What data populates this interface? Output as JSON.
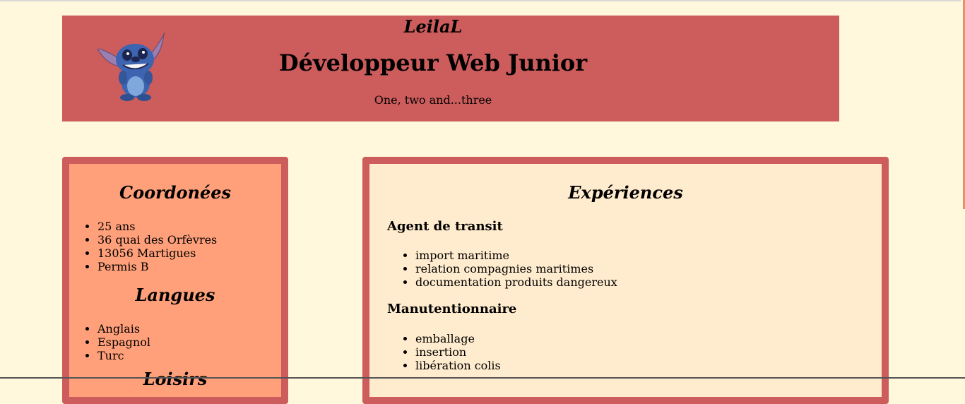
{
  "header": {
    "author": "LeilaL",
    "title": "Développeur Web Junior",
    "tagline": "One, two and...three",
    "logo_icon": "stitch-character-icon"
  },
  "contact": {
    "title": "Coordonées",
    "items": [
      "25 ans",
      "36 quai des Orfèvres",
      "13056 Martigues",
      "Permis B"
    ]
  },
  "languages": {
    "title": "Langues",
    "items": [
      "Anglais",
      "Espagnol",
      "Turc"
    ]
  },
  "hobbies": {
    "title": "Loisirs"
  },
  "experiences": {
    "title": "Expériences",
    "jobs": [
      {
        "title": "Agent de transit",
        "tasks": [
          "import maritime",
          "relation compagnies maritimes",
          "documentation produits dangereux"
        ]
      },
      {
        "title": "Manutentionnaire",
        "tasks": [
          "emballage",
          "insertion",
          "libération colis"
        ]
      }
    ]
  },
  "colors": {
    "background": "#fff8dc",
    "header": "#cd5c5c",
    "left_panel": "#ffa07a",
    "right_panel": "#ffebcd",
    "border": "#cd5c5c"
  }
}
